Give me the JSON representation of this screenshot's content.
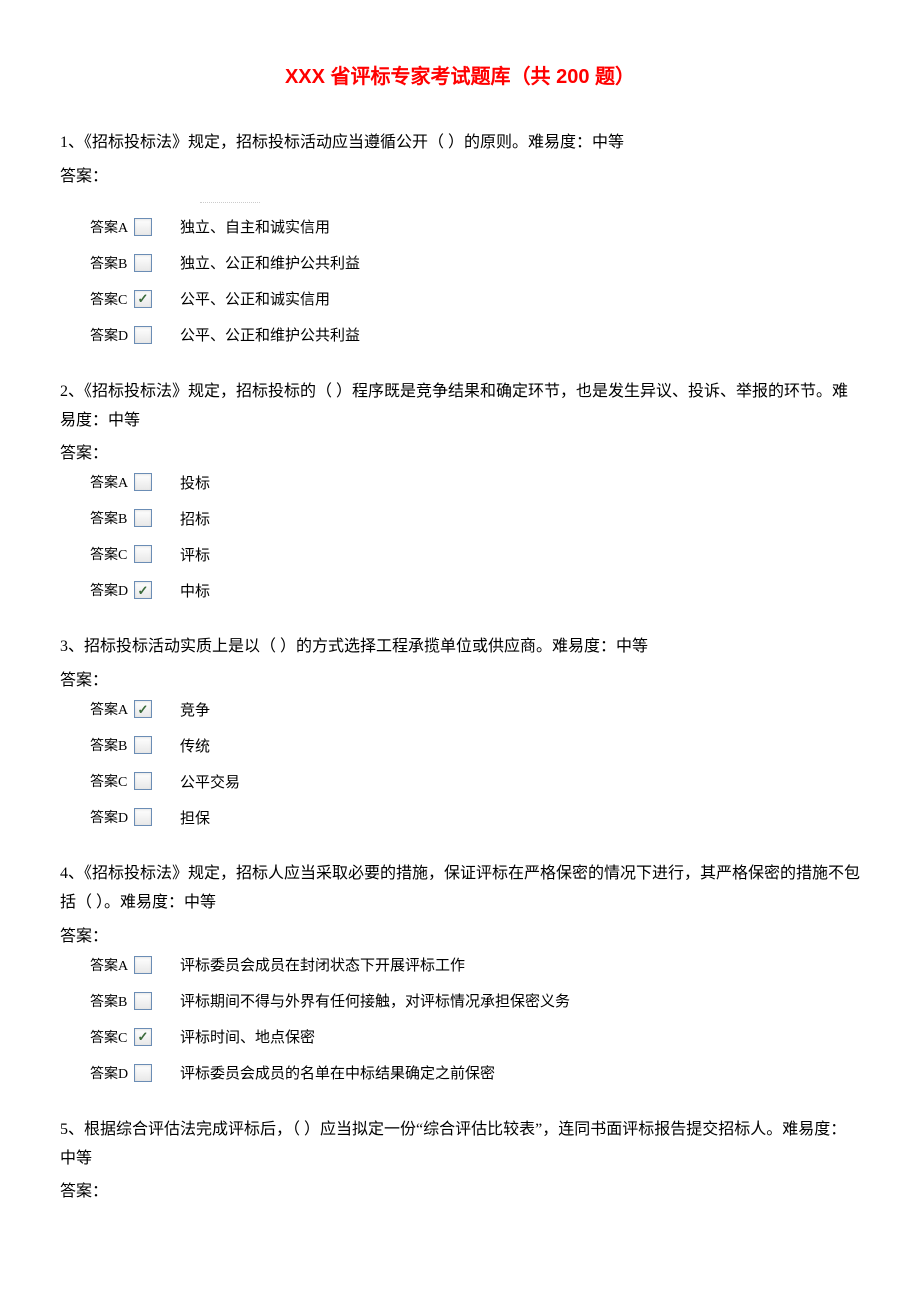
{
  "title": "XXX 省评标专家考试题库（共 200 题）",
  "answer_prefix": "答案：",
  "option_labels": [
    "答案A",
    "答案B",
    "答案C",
    "答案D"
  ],
  "questions": [
    {
      "text": "1、《招标投标法》规定，招标投标活动应当遵循公开（  ）的原则。难易度：中等",
      "options": [
        {
          "text": "独立、自主和诚实信用",
          "checked": false
        },
        {
          "text": "独立、公正和维护公共利益",
          "checked": false
        },
        {
          "text": "公平、公正和诚实信用",
          "checked": true
        },
        {
          "text": "公平、公正和维护公共利益",
          "checked": false
        }
      ]
    },
    {
      "text": "2、《招标投标法》规定，招标投标的（  ）程序既是竞争结果和确定环节，也是发生异议、投诉、举报的环节。难易度：中等",
      "options": [
        {
          "text": "投标",
          "checked": false
        },
        {
          "text": "招标",
          "checked": false
        },
        {
          "text": "评标",
          "checked": false
        },
        {
          "text": "中标",
          "checked": true
        }
      ]
    },
    {
      "text": "3、招标投标活动实质上是以（  ）的方式选择工程承揽单位或供应商。难易度：中等",
      "options": [
        {
          "text": "竞争",
          "checked": true
        },
        {
          "text": "传统",
          "checked": false
        },
        {
          "text": "公平交易",
          "checked": false
        },
        {
          "text": "担保",
          "checked": false
        }
      ]
    },
    {
      "text": "4、《招标投标法》规定，招标人应当采取必要的措施，保证评标在严格保密的情况下进行，其严格保密的措施不包括（  ）。难易度：中等",
      "options": [
        {
          "text": "评标委员会成员在封闭状态下开展评标工作",
          "checked": false
        },
        {
          "text": "评标期间不得与外界有任何接触，对评标情况承担保密义务",
          "checked": false
        },
        {
          "text": "评标时间、地点保密",
          "checked": true
        },
        {
          "text": "评标委员会成员的名单在中标结果确定之前保密",
          "checked": false
        }
      ]
    },
    {
      "text": "5、根据综合评估法完成评标后，（  ）应当拟定一份“综合评估比较表”，连同书面评标报告提交招标人。难易度：中等",
      "options": []
    }
  ]
}
